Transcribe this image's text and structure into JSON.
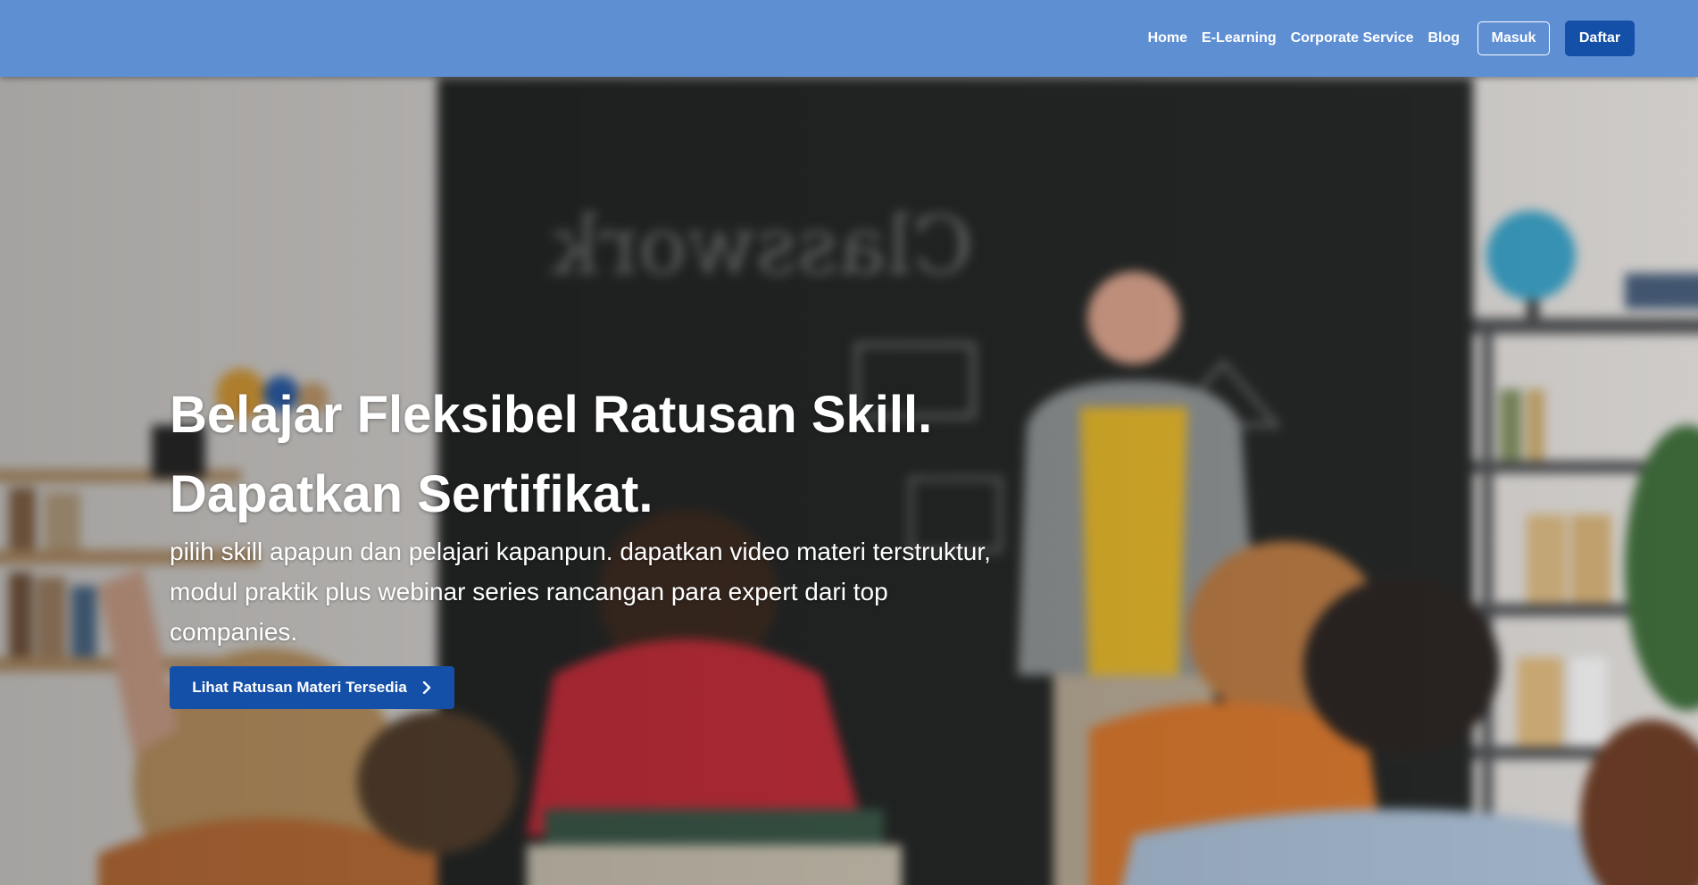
{
  "nav": {
    "links": [
      "Home",
      "E-Learning",
      "Corporate Service",
      "Blog"
    ],
    "login_label": "Masuk",
    "register_label": "Daftar"
  },
  "hero": {
    "title_line1": "Belajar Fleksibel Ratusan Skill.",
    "title_line2": "Dapatkan Sertifikat.",
    "description": "pilih skill apapun dan pelajari kapanpun. dapatkan video materi terstruktur, modul praktik plus webinar series rancangan para expert dari top companies.",
    "cta_label": "Lihat Ratusan Materi Tersedia",
    "cta_icon": "chevron-right-icon",
    "background_image_text": "Classwork"
  },
  "colors": {
    "navbar_bg": "#5f8fd3",
    "primary_button": "#1550a8",
    "text": "#ffffff"
  }
}
